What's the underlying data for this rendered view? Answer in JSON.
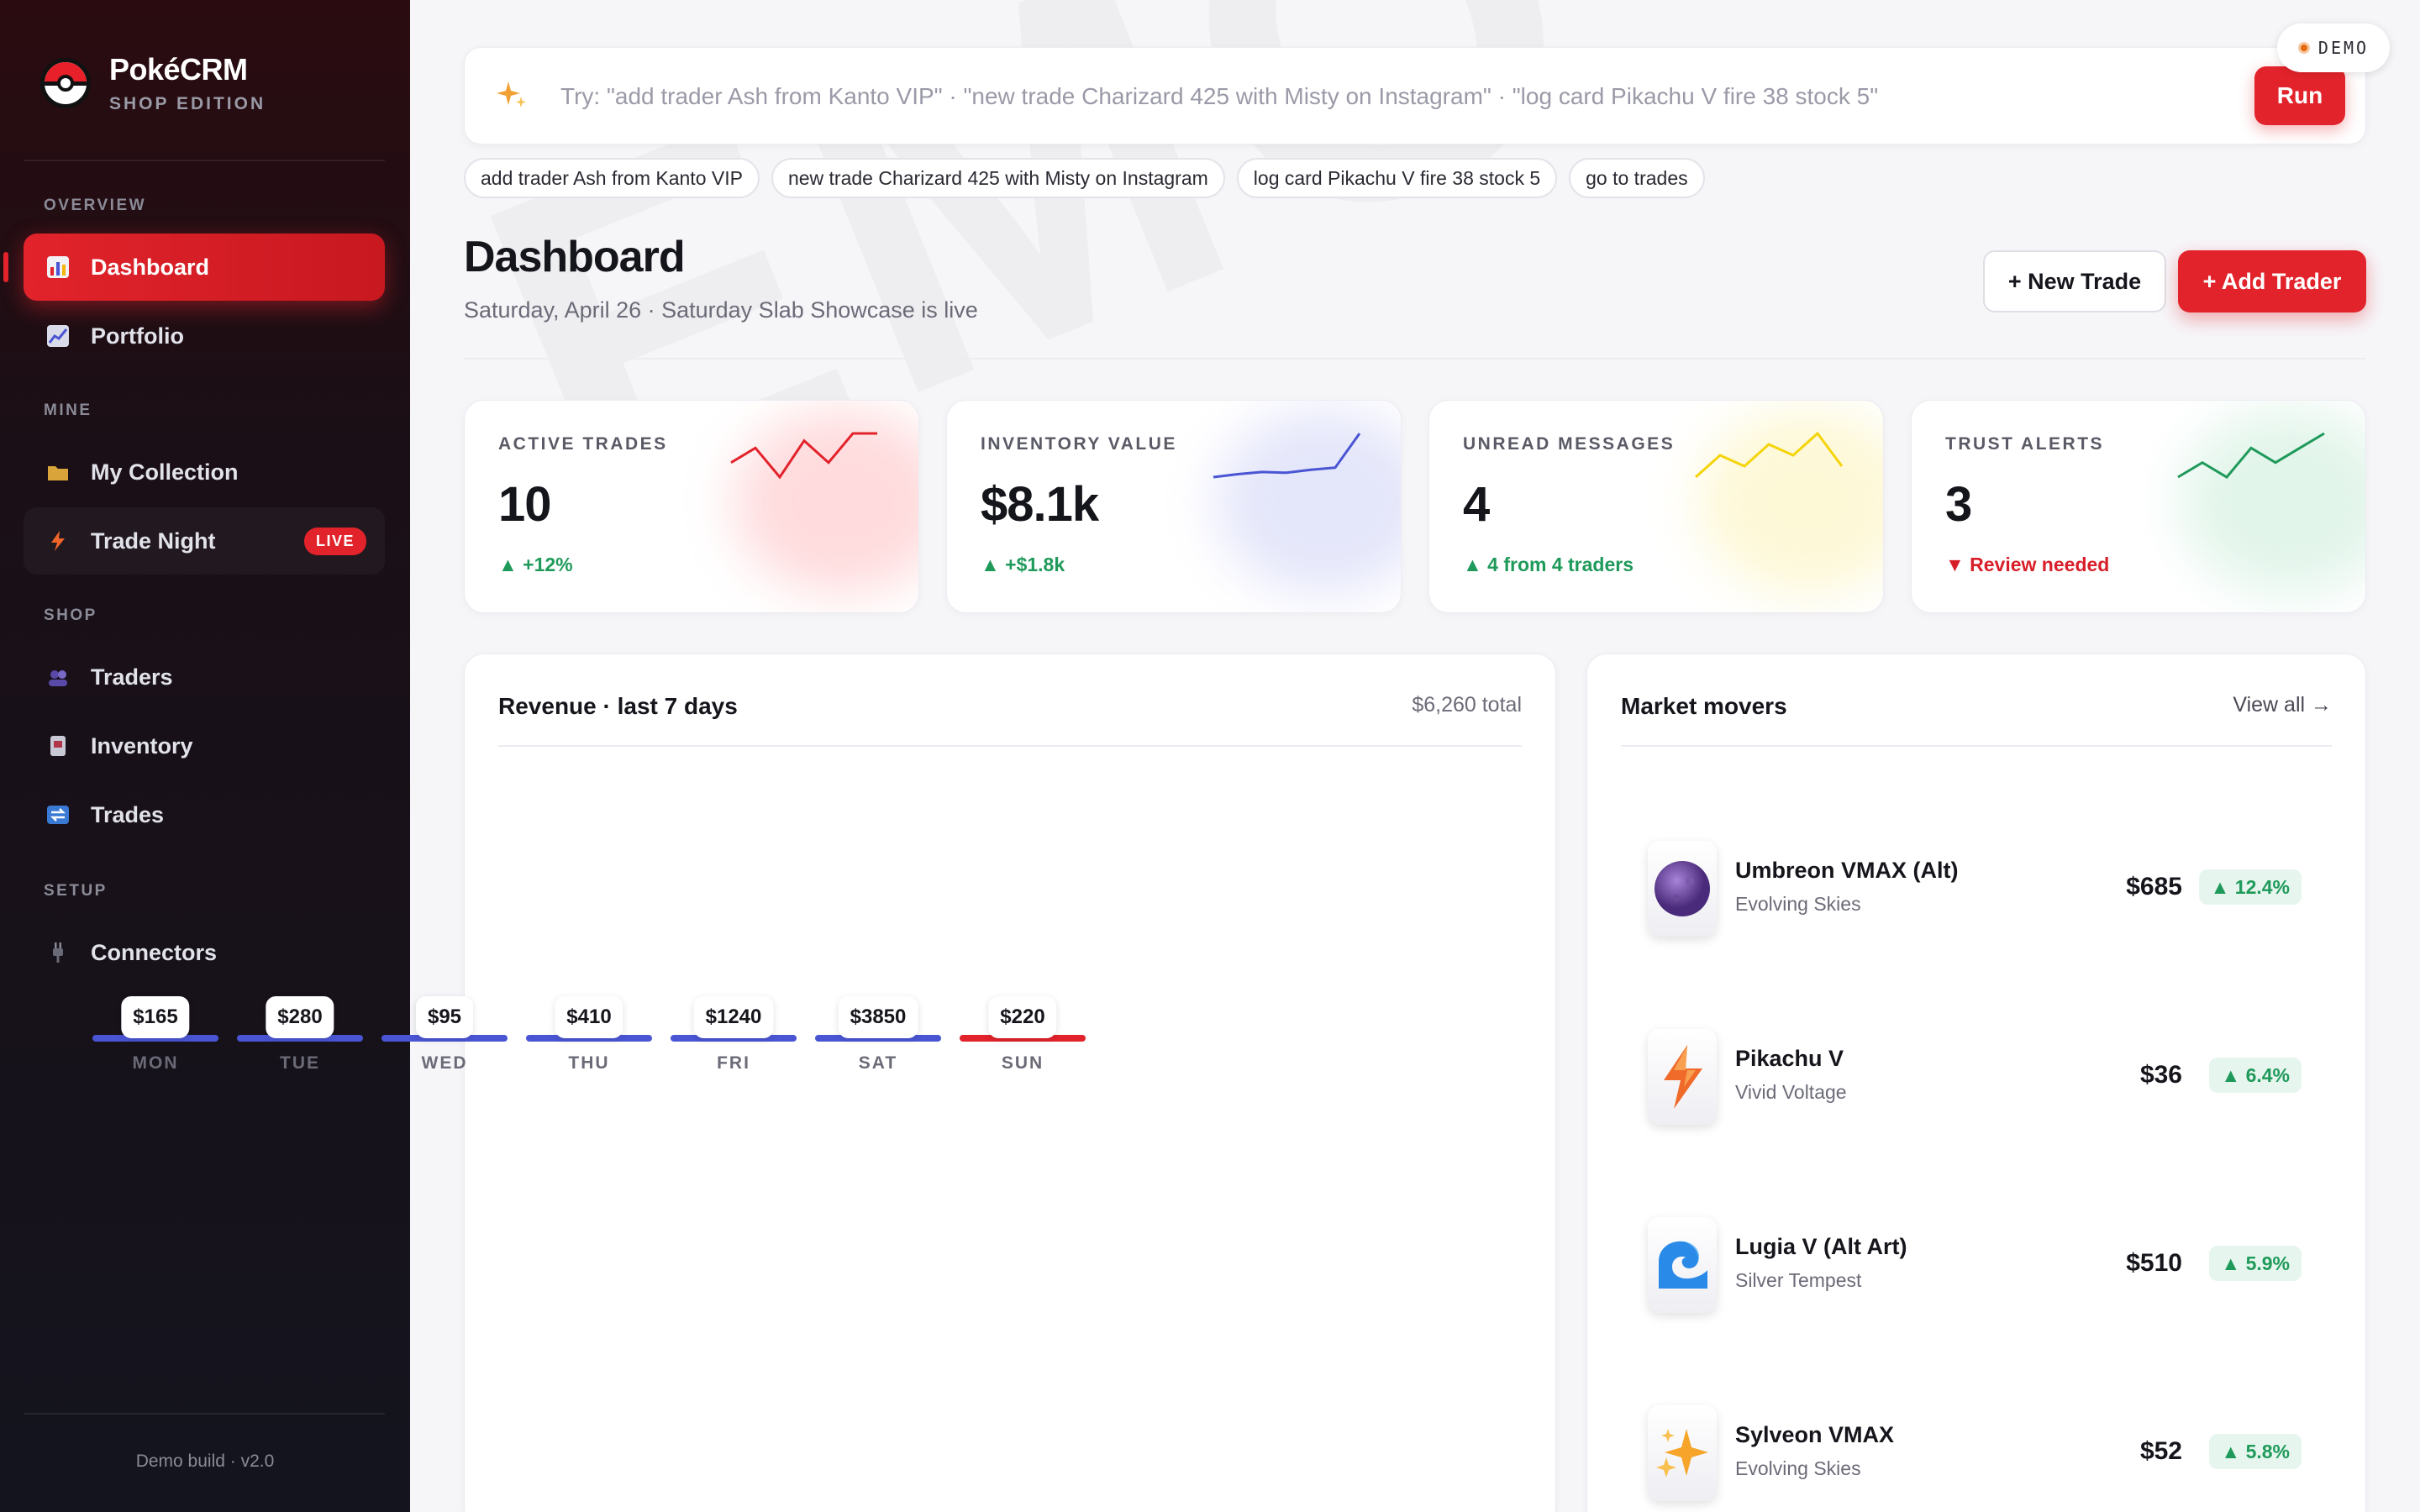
{
  "app": {
    "name": "PokéCRM",
    "edition": "SHOP EDITION",
    "demo_badge": "DEMO",
    "footer": "Demo build · v2.0"
  },
  "sidebar": {
    "sections": [
      {
        "label": "OVERVIEW",
        "items": [
          {
            "label": "Dashboard",
            "icon": "bar-chart-icon",
            "active": true
          },
          {
            "label": "Portfolio",
            "icon": "line-chart-icon"
          }
        ]
      },
      {
        "label": "MINE",
        "items": [
          {
            "label": "My Collection",
            "icon": "folder-icon"
          },
          {
            "label": "Trade Night",
            "icon": "lightning-icon",
            "badge": "LIVE"
          }
        ]
      },
      {
        "label": "SHOP",
        "items": [
          {
            "label": "Traders",
            "icon": "users-icon"
          },
          {
            "label": "Inventory",
            "icon": "card-icon"
          },
          {
            "label": "Trades",
            "icon": "exchange-icon"
          }
        ]
      },
      {
        "label": "SETUP",
        "items": [
          {
            "label": "Connectors",
            "icon": "plug-icon"
          }
        ]
      }
    ]
  },
  "command": {
    "placeholder": "Try: \"add trader Ash from Kanto VIP\" · \"new trade Charizard 425 with Misty on Instagram\" · \"log card Pikachu V fire 38 stock 5\"",
    "run_label": "Run",
    "icon": "sparkle-icon",
    "suggestions": [
      "add trader Ash from Kanto VIP",
      "new trade Charizard 425 with Misty on Instagram",
      "log card Pikachu V fire 38 stock 5",
      "go to trades"
    ]
  },
  "header": {
    "title": "Dashboard",
    "subtitle": "Saturday, April 26 · Saturday Slab Showcase is live",
    "new_trade_label": "+ New Trade",
    "add_trader_label": "+ Add Trader"
  },
  "kpis": [
    {
      "label": "ACTIVE TRADES",
      "value": "10",
      "delta": "▲ +12%",
      "trend": "up",
      "color": "#e2232b",
      "spark": [
        5,
        7,
        3,
        8,
        5,
        9,
        9
      ]
    },
    {
      "label": "INVENTORY VALUE",
      "value": "$8.1k",
      "delta": "▲ +$1.8k",
      "trend": "up",
      "color": "#4a55d4",
      "spark": [
        2,
        2.4,
        2.7,
        2.6,
        3,
        3.3,
        8
      ]
    },
    {
      "label": "UNREAD MESSAGES",
      "value": "4",
      "delta": "▲ 4 from 4 traders",
      "trend": "up",
      "color": "#f5d40a",
      "spark": [
        3,
        5,
        4,
        6,
        5,
        7,
        4
      ]
    },
    {
      "label": "TRUST ALERTS",
      "value": "3",
      "delta": "▼ Review needed",
      "trend": "down",
      "color": "#1f9a5a",
      "spark": [
        2,
        4,
        2,
        6,
        4,
        6,
        8
      ]
    }
  ],
  "revenue": {
    "title": "Revenue · last 7 days",
    "total": "$6,260 total",
    "days": [
      {
        "day": "MON",
        "value": "$165"
      },
      {
        "day": "TUE",
        "value": "$280"
      },
      {
        "day": "WED",
        "value": "$95"
      },
      {
        "day": "THU",
        "value": "$410"
      },
      {
        "day": "FRI",
        "value": "$1240"
      },
      {
        "day": "SAT",
        "value": "$3850"
      },
      {
        "day": "SUN",
        "value": "$220",
        "highlight": true
      }
    ]
  },
  "movers": {
    "title": "Market movers",
    "view_all": "View all →",
    "items": [
      {
        "name": "Umbreon VMAX (Alt)",
        "set": "Evolving Skies",
        "price": "$685",
        "change": "▲ 12.4%",
        "icon": "moon-orb-icon"
      },
      {
        "name": "Pikachu V",
        "set": "Vivid Voltage",
        "price": "$36",
        "change": "▲ 6.4%",
        "icon": "lightning-icon"
      },
      {
        "name": "Lugia V (Alt Art)",
        "set": "Silver Tempest",
        "price": "$510",
        "change": "▲ 5.9%",
        "icon": "wave-icon"
      },
      {
        "name": "Sylveon VMAX",
        "set": "Evolving Skies",
        "price": "$52",
        "change": "▲ 5.8%",
        "icon": "sparkle-icon"
      }
    ]
  }
}
